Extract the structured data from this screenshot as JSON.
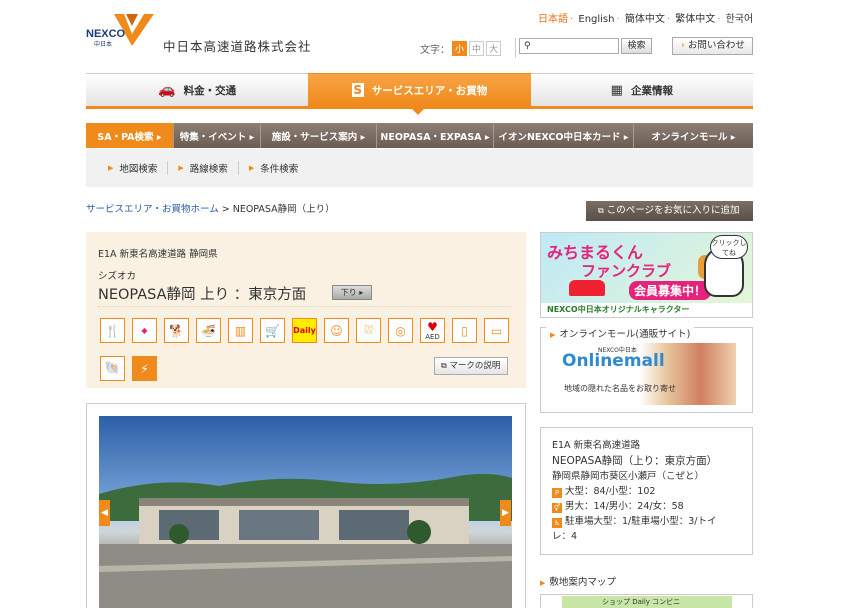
{
  "header": {
    "logo_text": "中日本高速道路株式会社",
    "logo_mark_text": "NEXCO",
    "logo_mark_sub": "中日本",
    "languages": [
      "日本語",
      "English",
      "簡体中文",
      "繁体中文",
      "한국어"
    ],
    "font_size_label": "文字：",
    "font_sizes": [
      "小",
      "中",
      "大"
    ],
    "search_button": "検索",
    "contact_button": "お問い合わせ"
  },
  "main_nav": [
    {
      "label": "料金・交通"
    },
    {
      "label": "サービスエリア・お買物"
    },
    {
      "label": "企業情報"
    }
  ],
  "sub_nav": [
    {
      "label": "SA・PA検索 ▸"
    },
    {
      "label": "特集・イベント ▸"
    },
    {
      "label": "施設・サービス案内 ▸"
    },
    {
      "label": "NEOPASA・EXPASA ▸"
    },
    {
      "label": "イオンNEXCO中日本カード ▸"
    },
    {
      "label": "オンラインモール ▸"
    }
  ],
  "sub_nav2": [
    {
      "label": "地図検索"
    },
    {
      "label": "路線検索"
    },
    {
      "label": "条件検索"
    }
  ],
  "breadcrumb": {
    "home": "サービスエリア・お買物ホーム",
    "sep": " > ",
    "current": "NEOPASA静岡（上り）"
  },
  "favorite_button": "このページをお気に入りに追加",
  "sa_info": {
    "route": "E1A  新東名高速道路 静岡県",
    "kana": "シズオカ",
    "name": "NEOPASA静岡 上り ：東京方面",
    "direction_badge": "下り ▸",
    "mark_button": "マークの説明"
  },
  "facility_icons": [
    "restaurant-icon",
    "shopping-icon",
    "dog-run-icon",
    "food-court-icon",
    "vending-icon",
    "shop-icon",
    "daily-convenience-icon",
    "baby-room-icon",
    "shower-icon",
    "laundry-icon",
    "aed-icon",
    "atm-icon",
    "info-terminal-icon",
    "shell-gas-icon",
    "ev-charger-icon"
  ],
  "facility_icon_text": {
    "daily": "Daily",
    "aed": "AED"
  },
  "side": {
    "banner1": {
      "line1": "みちまるくん",
      "line2": "ファンクラブ",
      "line3": "会員募集中！",
      "bubble": "クリックしてね",
      "footer": "NEXCO中日本オリジナルキャラクター"
    },
    "online_title": "オンラインモール(通販サイト)",
    "online_banner": {
      "logo": "Onlinemall",
      "nexco": "NEXCO中日本",
      "sub": "地域の隠れた名品をお取り寄せ"
    },
    "detail": {
      "route": "E1A  新東名高速道路",
      "name": "NEOPASA静岡（上り：東京方面）",
      "address": "静岡県静岡市葵区小瀬戸（こぜと）",
      "parking": "大型：84/小型：102",
      "toilet": "男大：14/男小：24/女：58",
      "accessible_1": "駐車場大型：1/駐車場小型：3/トイ",
      "accessible_2": "レ：4"
    },
    "map_title": "敷地案内マップ",
    "map_preview": "ショップ  Daily  コンビニ"
  }
}
